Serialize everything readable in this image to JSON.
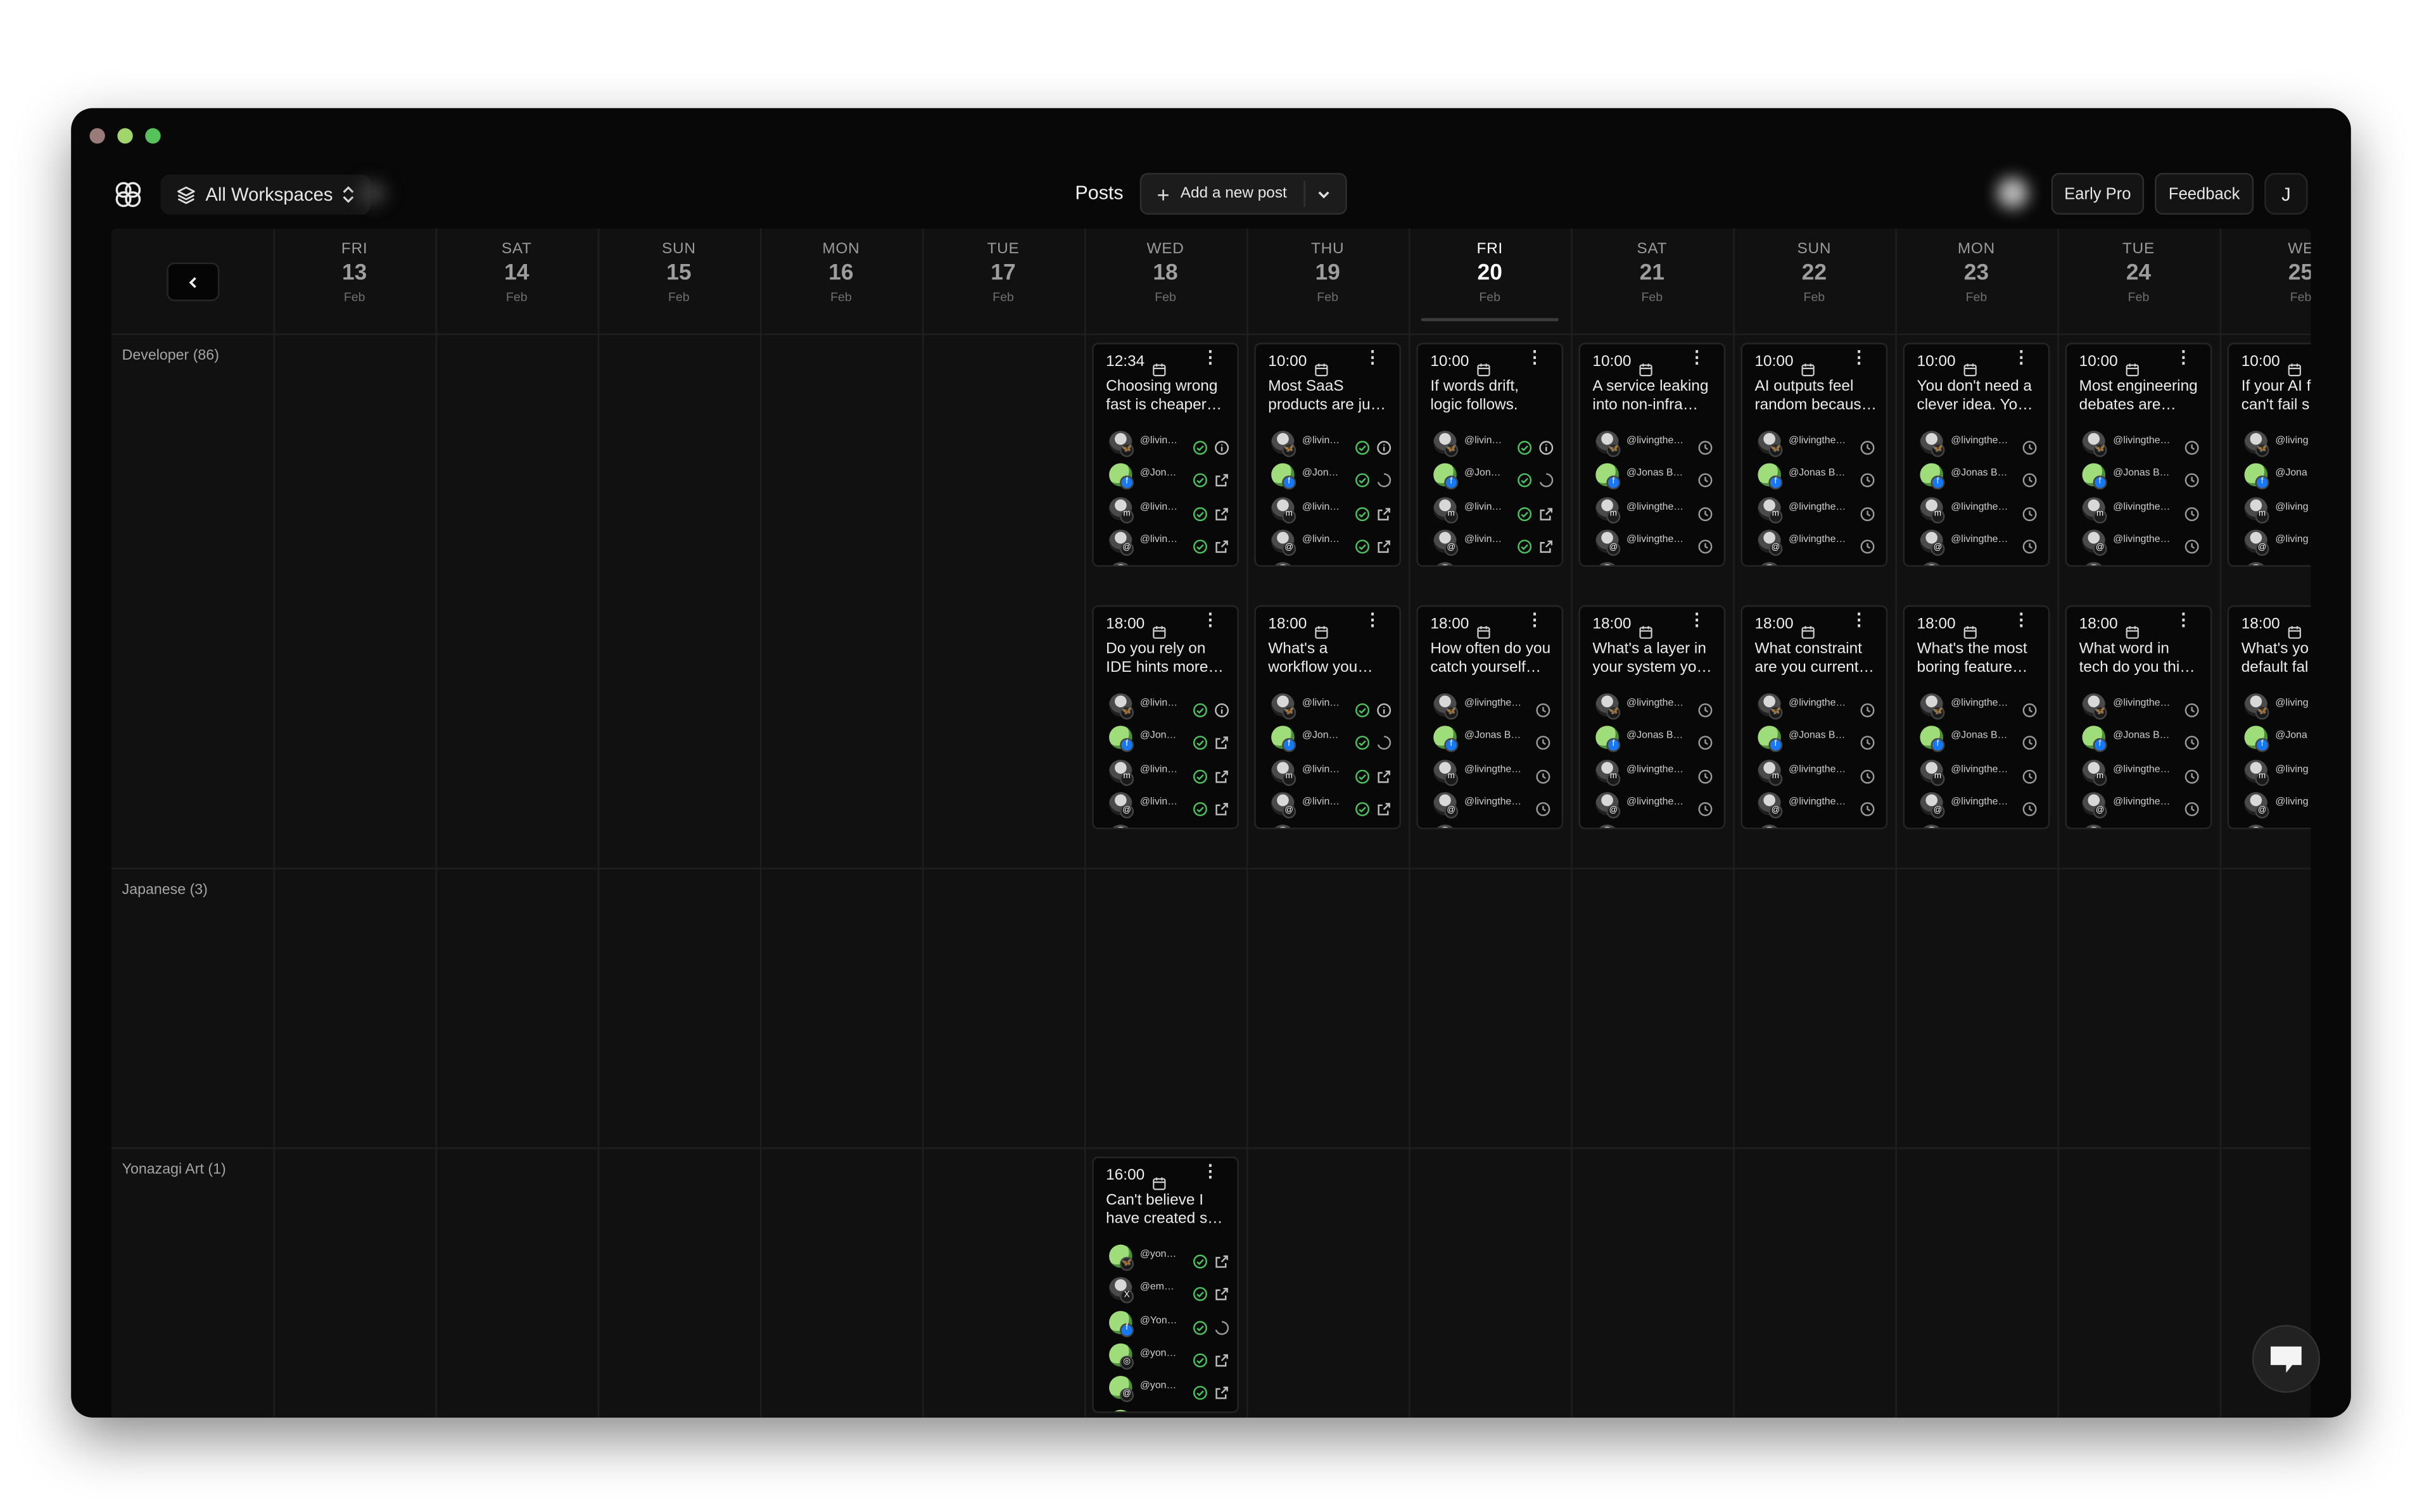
{
  "window": {
    "traffic_colors": [
      "#9b7a7a",
      "#a2d56c",
      "#56c35a"
    ]
  },
  "header": {
    "workspace_label": "All Workspaces",
    "posts_title": "Posts",
    "add_post_label": "Add a new post",
    "early_pro_label": "Early Pro",
    "feedback_label": "Feedback",
    "avatar_initial": "J"
  },
  "days": [
    {
      "dow": "FRI",
      "num": "13",
      "month": "Feb"
    },
    {
      "dow": "SAT",
      "num": "14",
      "month": "Feb"
    },
    {
      "dow": "SUN",
      "num": "15",
      "month": "Feb"
    },
    {
      "dow": "MON",
      "num": "16",
      "month": "Feb"
    },
    {
      "dow": "TUE",
      "num": "17",
      "month": "Feb"
    },
    {
      "dow": "WED",
      "num": "18",
      "month": "Feb"
    },
    {
      "dow": "THU",
      "num": "19",
      "month": "Feb"
    },
    {
      "dow": "FRI",
      "num": "20",
      "month": "Feb",
      "today": true
    },
    {
      "dow": "SAT",
      "num": "21",
      "month": "Feb"
    },
    {
      "dow": "SUN",
      "num": "22",
      "month": "Feb"
    },
    {
      "dow": "MON",
      "num": "23",
      "month": "Feb"
    },
    {
      "dow": "TUE",
      "num": "24",
      "month": "Feb"
    },
    {
      "dow": "WE",
      "num": "25",
      "month": "Feb"
    }
  ],
  "rows": [
    {
      "label": "Developer (86)"
    },
    {
      "label": "Japanese (3)"
    },
    {
      "label": "Yonazagi Art (1)"
    }
  ],
  "posts": [
    {
      "row": 0,
      "slot": 0,
      "day": 5,
      "time": "12:34",
      "lines": [
        "Choosing wrong",
        "fast is cheaper…"
      ],
      "accounts": [
        {
          "handle": "@livin…",
          "platform": "bluesky",
          "s1": "check",
          "s2": "info"
        },
        {
          "handle": "@Jon…",
          "platform": "facebook",
          "s1": "check",
          "s2": "external"
        },
        {
          "handle": "@livin…",
          "platform": "mastodon",
          "s1": "check",
          "s2": "external"
        },
        {
          "handle": "@livin…",
          "platform": "threads",
          "s1": "check",
          "s2": "external"
        },
        {
          "handle": "@livin…",
          "platform": "x",
          "s1": "check",
          "s2": "external"
        }
      ]
    },
    {
      "row": 0,
      "slot": 0,
      "day": 6,
      "time": "10:00",
      "lines": [
        "Most SaaS",
        "products are ju…"
      ],
      "accounts": [
        {
          "handle": "@livin…",
          "platform": "bluesky",
          "s1": "check",
          "s2": "info"
        },
        {
          "handle": "@Jon…",
          "platform": "facebook",
          "s1": "check",
          "s2": "spinner"
        },
        {
          "handle": "@livin…",
          "platform": "mastodon",
          "s1": "check",
          "s2": "external"
        },
        {
          "handle": "@livin…",
          "platform": "threads",
          "s1": "check",
          "s2": "external"
        },
        {
          "handle": "@livin…",
          "platform": "x",
          "s1": "check",
          "s2": "external"
        }
      ]
    },
    {
      "row": 0,
      "slot": 0,
      "day": 7,
      "time": "10:00",
      "lines": [
        "If words drift,",
        "logic follows."
      ],
      "accounts": [
        {
          "handle": "@livin…",
          "platform": "bluesky",
          "s1": "check",
          "s2": "info"
        },
        {
          "handle": "@Jon…",
          "platform": "facebook",
          "s1": "check",
          "s2": "spinner"
        },
        {
          "handle": "@livin…",
          "platform": "mastodon",
          "s1": "check",
          "s2": "external"
        },
        {
          "handle": "@livin…",
          "platform": "threads",
          "s1": "check",
          "s2": "external"
        },
        {
          "handle": "@livin…",
          "platform": "x",
          "s1": "check",
          "s2": "external"
        }
      ]
    },
    {
      "row": 0,
      "slot": 0,
      "day": 8,
      "time": "10:00",
      "lines": [
        "A service leaking",
        "into non-infra…"
      ],
      "accounts": [
        {
          "handle": "@livingthe…",
          "platform": "bluesky",
          "s1": "clock"
        },
        {
          "handle": "@Jonas B…",
          "platform": "facebook",
          "s1": "clock"
        },
        {
          "handle": "@livingthe…",
          "platform": "mastodon",
          "s1": "clock"
        },
        {
          "handle": "@livingthe…",
          "platform": "threads",
          "s1": "clock"
        },
        {
          "handle": "@livingthe…",
          "platform": "x",
          "s1": "clock"
        }
      ]
    },
    {
      "row": 0,
      "slot": 0,
      "day": 9,
      "time": "10:00",
      "lines": [
        "AI outputs feel",
        "random becaus…"
      ],
      "accounts": [
        {
          "handle": "@livingthe…",
          "platform": "bluesky",
          "s1": "clock"
        },
        {
          "handle": "@Jonas B…",
          "platform": "facebook",
          "s1": "clock"
        },
        {
          "handle": "@livingthe…",
          "platform": "mastodon",
          "s1": "clock"
        },
        {
          "handle": "@livingthe…",
          "platform": "threads",
          "s1": "clock"
        },
        {
          "handle": "@livingthe…",
          "platform": "x",
          "s1": "clock"
        }
      ]
    },
    {
      "row": 0,
      "slot": 0,
      "day": 10,
      "time": "10:00",
      "lines": [
        "You don't need a",
        "clever idea. Yo…"
      ],
      "accounts": [
        {
          "handle": "@livingthe…",
          "platform": "bluesky",
          "s1": "clock"
        },
        {
          "handle": "@Jonas B…",
          "platform": "facebook",
          "s1": "clock"
        },
        {
          "handle": "@livingthe…",
          "platform": "mastodon",
          "s1": "clock"
        },
        {
          "handle": "@livingthe…",
          "platform": "threads",
          "s1": "clock"
        },
        {
          "handle": "@livingthe…",
          "platform": "x",
          "s1": "clock"
        }
      ]
    },
    {
      "row": 0,
      "slot": 0,
      "day": 11,
      "time": "10:00",
      "lines": [
        "Most engineering",
        "debates are…"
      ],
      "accounts": [
        {
          "handle": "@livingthe…",
          "platform": "bluesky",
          "s1": "clock"
        },
        {
          "handle": "@Jonas B…",
          "platform": "facebook",
          "s1": "clock"
        },
        {
          "handle": "@livingthe…",
          "platform": "mastodon",
          "s1": "clock"
        },
        {
          "handle": "@livingthe…",
          "platform": "threads",
          "s1": "clock"
        },
        {
          "handle": "@livingthe…",
          "platform": "x",
          "s1": "clock"
        }
      ]
    },
    {
      "row": 0,
      "slot": 0,
      "day": 12,
      "time": "10:00",
      "lines": [
        "If your AI f",
        "can't fail s"
      ],
      "accounts": [
        {
          "handle": "@living",
          "platform": "bluesky",
          "s1": "none"
        },
        {
          "handle": "@Jona",
          "platform": "facebook",
          "s1": "none"
        },
        {
          "handle": "@living",
          "platform": "mastodon",
          "s1": "none"
        },
        {
          "handle": "@living",
          "platform": "threads",
          "s1": "none"
        },
        {
          "handle": "@living",
          "platform": "x",
          "s1": "none"
        }
      ]
    },
    {
      "row": 0,
      "slot": 1,
      "day": 5,
      "time": "18:00",
      "lines": [
        "Do you rely on",
        "IDE hints more…"
      ],
      "accounts": [
        {
          "handle": "@livin…",
          "platform": "bluesky",
          "s1": "check",
          "s2": "info"
        },
        {
          "handle": "@Jon…",
          "platform": "facebook",
          "s1": "check",
          "s2": "external"
        },
        {
          "handle": "@livin…",
          "platform": "mastodon",
          "s1": "check",
          "s2": "external"
        },
        {
          "handle": "@livin…",
          "platform": "threads",
          "s1": "check",
          "s2": "external"
        },
        {
          "handle": "@livin…",
          "platform": "x",
          "s1": "check",
          "s2": "external"
        }
      ]
    },
    {
      "row": 0,
      "slot": 1,
      "day": 6,
      "time": "18:00",
      "lines": [
        "What's a",
        "workflow you…"
      ],
      "accounts": [
        {
          "handle": "@livin…",
          "platform": "bluesky",
          "s1": "check",
          "s2": "info"
        },
        {
          "handle": "@Jon…",
          "platform": "facebook",
          "s1": "check",
          "s2": "spinner"
        },
        {
          "handle": "@livin…",
          "platform": "mastodon",
          "s1": "check",
          "s2": "external"
        },
        {
          "handle": "@livin…",
          "platform": "threads",
          "s1": "check",
          "s2": "external"
        },
        {
          "handle": "@livin…",
          "platform": "x",
          "s1": "check",
          "s2": "external"
        }
      ]
    },
    {
      "row": 0,
      "slot": 1,
      "day": 7,
      "time": "18:00",
      "lines": [
        "How often do you",
        "catch yourself…"
      ],
      "accounts": [
        {
          "handle": "@livingthe…",
          "platform": "bluesky",
          "s1": "clock"
        },
        {
          "handle": "@Jonas B…",
          "platform": "facebook",
          "s1": "clock"
        },
        {
          "handle": "@livingthe…",
          "platform": "mastodon",
          "s1": "clock"
        },
        {
          "handle": "@livingthe…",
          "platform": "threads",
          "s1": "clock"
        },
        {
          "handle": "@livingthe…",
          "platform": "x",
          "s1": "clock"
        }
      ]
    },
    {
      "row": 0,
      "slot": 1,
      "day": 8,
      "time": "18:00",
      "lines": [
        "What's a layer in",
        "your system yo…"
      ],
      "accounts": [
        {
          "handle": "@livingthe…",
          "platform": "bluesky",
          "s1": "clock"
        },
        {
          "handle": "@Jonas B…",
          "platform": "facebook",
          "s1": "clock"
        },
        {
          "handle": "@livingthe…",
          "platform": "mastodon",
          "s1": "clock"
        },
        {
          "handle": "@livingthe…",
          "platform": "threads",
          "s1": "clock"
        },
        {
          "handle": "@livingthe…",
          "platform": "x",
          "s1": "clock"
        }
      ]
    },
    {
      "row": 0,
      "slot": 1,
      "day": 9,
      "time": "18:00",
      "lines": [
        "What constraint",
        "are you current…"
      ],
      "accounts": [
        {
          "handle": "@livingthe…",
          "platform": "bluesky",
          "s1": "clock"
        },
        {
          "handle": "@Jonas B…",
          "platform": "facebook",
          "s1": "clock"
        },
        {
          "handle": "@livingthe…",
          "platform": "mastodon",
          "s1": "clock"
        },
        {
          "handle": "@livingthe…",
          "platform": "threads",
          "s1": "clock"
        },
        {
          "handle": "@livingthe…",
          "platform": "x",
          "s1": "clock"
        }
      ]
    },
    {
      "row": 0,
      "slot": 1,
      "day": 10,
      "time": "18:00",
      "lines": [
        "What's the most",
        "boring feature…"
      ],
      "accounts": [
        {
          "handle": "@livingthe…",
          "platform": "bluesky",
          "s1": "clock"
        },
        {
          "handle": "@Jonas B…",
          "platform": "facebook",
          "s1": "clock"
        },
        {
          "handle": "@livingthe…",
          "platform": "mastodon",
          "s1": "clock"
        },
        {
          "handle": "@livingthe…",
          "platform": "threads",
          "s1": "clock"
        },
        {
          "handle": "@livingthe…",
          "platform": "x",
          "s1": "clock"
        }
      ]
    },
    {
      "row": 0,
      "slot": 1,
      "day": 11,
      "time": "18:00",
      "lines": [
        "What word in",
        "tech do you thi…"
      ],
      "accounts": [
        {
          "handle": "@livingthe…",
          "platform": "bluesky",
          "s1": "clock"
        },
        {
          "handle": "@Jonas B…",
          "platform": "facebook",
          "s1": "clock"
        },
        {
          "handle": "@livingthe…",
          "platform": "mastodon",
          "s1": "clock"
        },
        {
          "handle": "@livingthe…",
          "platform": "threads",
          "s1": "clock"
        },
        {
          "handle": "@livingthe…",
          "platform": "x",
          "s1": "clock"
        }
      ]
    },
    {
      "row": 0,
      "slot": 1,
      "day": 12,
      "time": "18:00",
      "lines": [
        "What's yo",
        "default fal"
      ],
      "accounts": [
        {
          "handle": "@living",
          "platform": "bluesky",
          "s1": "none"
        },
        {
          "handle": "@Jona",
          "platform": "facebook",
          "s1": "none"
        },
        {
          "handle": "@living",
          "platform": "mastodon",
          "s1": "none"
        },
        {
          "handle": "@living",
          "platform": "threads",
          "s1": "none"
        },
        {
          "handle": "@living",
          "platform": "x",
          "s1": "none"
        }
      ]
    },
    {
      "row": 2,
      "slot": 0,
      "day": 5,
      "time": "16:00",
      "lines": [
        "Can't believe I",
        "have created s…"
      ],
      "accounts": [
        {
          "handle": "@yon…",
          "platform": "bluesky",
          "s1": "check",
          "s2": "external",
          "green": true
        },
        {
          "handle": "@em…",
          "platform": "x",
          "s1": "check",
          "s2": "external"
        },
        {
          "handle": "@Yon…",
          "platform": "facebook",
          "s1": "check",
          "s2": "spinner",
          "green": true
        },
        {
          "handle": "@yon…",
          "platform": "instagram",
          "s1": "check",
          "s2": "external",
          "green": true
        },
        {
          "handle": "@yon…",
          "platform": "threads",
          "s1": "check",
          "s2": "external",
          "green": true
        },
        {
          "handle": "@…",
          "platform": "mastodon",
          "s1": "check",
          "s2": "external",
          "green": true
        }
      ]
    }
  ],
  "icons": {
    "platforms": {
      "bluesky": "butterfly-icon",
      "facebook": "facebook-icon",
      "mastodon": "mastodon-icon",
      "threads": "threads-icon",
      "x": "x-icon",
      "instagram": "instagram-icon"
    },
    "status": {
      "check": "check-circle-icon",
      "info": "info-icon",
      "external": "external-link-icon",
      "spinner": "loading-icon",
      "clock": "clock-icon"
    }
  },
  "colors": {
    "accent_green": "#4cc35f",
    "background": "#080808",
    "grid": "#1f1f1f"
  }
}
